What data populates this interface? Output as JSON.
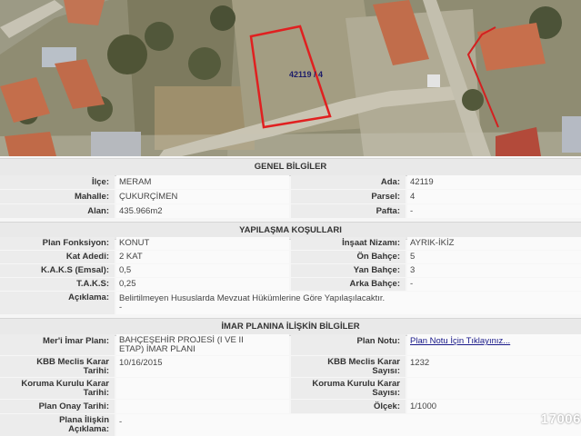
{
  "map": {
    "parcel_label": "42119 / 4"
  },
  "genel": {
    "title": "GENEL BİLGİLER",
    "ilce_label": "İlçe:",
    "ilce": "MERAM",
    "ada_label": "Ada:",
    "ada": "42119",
    "mahalle_label": "Mahalle:",
    "mahalle": "ÇUKURÇİMEN",
    "parsel_label": "Parsel:",
    "parsel": "4",
    "alan_label": "Alan:",
    "alan": "435.966m2",
    "pafta_label": "Pafta:",
    "pafta": "-"
  },
  "yapilasma": {
    "title": "YAPILAŞMA KOŞULLARI",
    "fonksiyon_label": "Plan Fonksiyon:",
    "fonksiyon": "KONUT",
    "nizam_label": "İnşaat Nizamı:",
    "nizam": "AYRIK-İKİZ",
    "kat_label": "Kat Adedi:",
    "kat": "2 KAT",
    "on_label": "Ön Bahçe:",
    "on": "5",
    "kaks_label": "K.A.K.S (Emsal):",
    "kaks": "0,5",
    "yan_label": "Yan Bahçe:",
    "yan": "3",
    "taks_label": "T.A.K.S:",
    "taks": "0,25",
    "arka_label": "Arka Bahçe:",
    "arka": "-",
    "aciklama_label": "Açıklama:",
    "aciklama1": "Belirtilmeyen Hususlarda Mevzuat Hükümlerine Göre Yapılaşılacaktır.",
    "aciklama2": "-"
  },
  "imar": {
    "title": "İMAR PLANINA İLİŞKİN BİLGİLER",
    "meri_label": "Mer'i İmar Planı:",
    "meri1": "BAHÇEŞEHİR PROJESİ (I VE II",
    "meri2": "ETAP) İMAR PLANI",
    "notu_label": "Plan Notu:",
    "notu_link": "Plan Notu İçin Tıklayınız...",
    "kbb_tarih_label1": "KBB Meclis Karar",
    "kbb_tarih_label2": "Tarihi:",
    "kbb_tarih": "10/16/2015",
    "kbb_sayi_label1": "KBB Meclis Karar",
    "kbb_sayi_label2": "Sayısı:",
    "kbb_sayi": "1232",
    "kor_tarih_label1": "Koruma Kurulu Karar",
    "kor_tarih_label2": "Tarihi:",
    "kor_tarih": "",
    "kor_sayi_label1": "Koruma Kurulu Karar",
    "kor_sayi_label2": "Sayısı:",
    "kor_sayi": "",
    "onay_label": "Plan Onay Tarihi:",
    "onay": "",
    "olcek_label": "Ölçek:",
    "olcek": "1/1000",
    "iliskin_label1": "Plana İlişkin",
    "iliskin_label2": "Açıklama:",
    "iliskin": "-"
  },
  "watermark": "17006"
}
